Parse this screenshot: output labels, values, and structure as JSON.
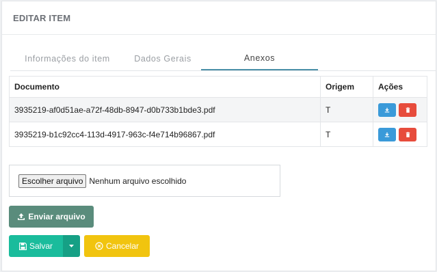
{
  "panel": {
    "title": "EDITAR ITEM"
  },
  "tabs": [
    {
      "label": "Informações do item",
      "active": false
    },
    {
      "label": "Dados Gerais",
      "active": false
    },
    {
      "label": "Anexos",
      "active": true
    }
  ],
  "table": {
    "headers": [
      "Documento",
      "Origem",
      "Ações"
    ],
    "rows": [
      {
        "documento": "3935219-af0d51ae-a72f-48db-8947-d0b733b1bde3.pdf",
        "origem": "T"
      },
      {
        "documento": "3935219-b1c92cc4-113d-4917-963c-f4e714b96867.pdf",
        "origem": "T"
      }
    ]
  },
  "upload": {
    "choose_label": "Escolher arquivo",
    "status": "Nenhum arquivo escolhido"
  },
  "buttons": {
    "send": "Enviar arquivo",
    "save": "Salvar",
    "cancel": "Cancelar"
  },
  "colors": {
    "send": "#5a8c7c",
    "save": "#1abc9c",
    "cancel": "#f1c40f",
    "download": "#3a9ad9",
    "delete": "#e74c3c"
  },
  "icons": {
    "download": "download-icon",
    "delete": "trash-icon",
    "send": "upload-icon",
    "save": "floppy-disk-icon",
    "dropdown": "caret-down-icon",
    "cancel": "times-circle-icon"
  }
}
